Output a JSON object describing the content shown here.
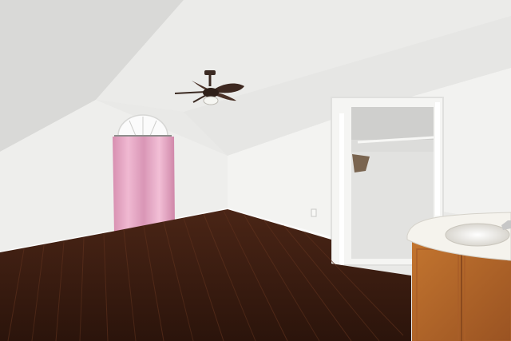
{
  "scene": {
    "kind": "photo",
    "subject": "attic-bedroom",
    "palette": {
      "ceiling": "#e8e8e6",
      "wall": "#f1f1ef",
      "floor_dark": "#3a1d12",
      "floor_light": "#6b3a22",
      "curtain": "#e3a6c2",
      "vanity": "#b8682c",
      "counter": "#f4f2ec",
      "fan": "#3b2a22"
    }
  }
}
